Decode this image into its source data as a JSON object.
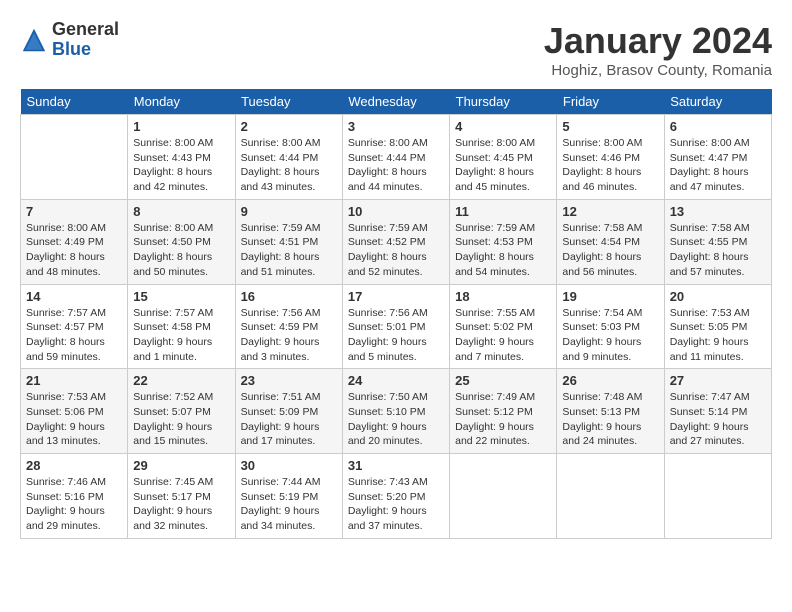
{
  "logo": {
    "general": "General",
    "blue": "Blue"
  },
  "header": {
    "month_title": "January 2024",
    "location": "Hoghiz, Brasov County, Romania"
  },
  "weekdays": [
    "Sunday",
    "Monday",
    "Tuesday",
    "Wednesday",
    "Thursday",
    "Friday",
    "Saturday"
  ],
  "weeks": [
    [
      {
        "day": "",
        "sunrise": "",
        "sunset": "",
        "daylight": ""
      },
      {
        "day": "1",
        "sunrise": "Sunrise: 8:00 AM",
        "sunset": "Sunset: 4:43 PM",
        "daylight": "Daylight: 8 hours and 42 minutes."
      },
      {
        "day": "2",
        "sunrise": "Sunrise: 8:00 AM",
        "sunset": "Sunset: 4:44 PM",
        "daylight": "Daylight: 8 hours and 43 minutes."
      },
      {
        "day": "3",
        "sunrise": "Sunrise: 8:00 AM",
        "sunset": "Sunset: 4:44 PM",
        "daylight": "Daylight: 8 hours and 44 minutes."
      },
      {
        "day": "4",
        "sunrise": "Sunrise: 8:00 AM",
        "sunset": "Sunset: 4:45 PM",
        "daylight": "Daylight: 8 hours and 45 minutes."
      },
      {
        "day": "5",
        "sunrise": "Sunrise: 8:00 AM",
        "sunset": "Sunset: 4:46 PM",
        "daylight": "Daylight: 8 hours and 46 minutes."
      },
      {
        "day": "6",
        "sunrise": "Sunrise: 8:00 AM",
        "sunset": "Sunset: 4:47 PM",
        "daylight": "Daylight: 8 hours and 47 minutes."
      }
    ],
    [
      {
        "day": "7",
        "sunrise": "Sunrise: 8:00 AM",
        "sunset": "Sunset: 4:49 PM",
        "daylight": "Daylight: 8 hours and 48 minutes."
      },
      {
        "day": "8",
        "sunrise": "Sunrise: 8:00 AM",
        "sunset": "Sunset: 4:50 PM",
        "daylight": "Daylight: 8 hours and 50 minutes."
      },
      {
        "day": "9",
        "sunrise": "Sunrise: 7:59 AM",
        "sunset": "Sunset: 4:51 PM",
        "daylight": "Daylight: 8 hours and 51 minutes."
      },
      {
        "day": "10",
        "sunrise": "Sunrise: 7:59 AM",
        "sunset": "Sunset: 4:52 PM",
        "daylight": "Daylight: 8 hours and 52 minutes."
      },
      {
        "day": "11",
        "sunrise": "Sunrise: 7:59 AM",
        "sunset": "Sunset: 4:53 PM",
        "daylight": "Daylight: 8 hours and 54 minutes."
      },
      {
        "day": "12",
        "sunrise": "Sunrise: 7:58 AM",
        "sunset": "Sunset: 4:54 PM",
        "daylight": "Daylight: 8 hours and 56 minutes."
      },
      {
        "day": "13",
        "sunrise": "Sunrise: 7:58 AM",
        "sunset": "Sunset: 4:55 PM",
        "daylight": "Daylight: 8 hours and 57 minutes."
      }
    ],
    [
      {
        "day": "14",
        "sunrise": "Sunrise: 7:57 AM",
        "sunset": "Sunset: 4:57 PM",
        "daylight": "Daylight: 8 hours and 59 minutes."
      },
      {
        "day": "15",
        "sunrise": "Sunrise: 7:57 AM",
        "sunset": "Sunset: 4:58 PM",
        "daylight": "Daylight: 9 hours and 1 minute."
      },
      {
        "day": "16",
        "sunrise": "Sunrise: 7:56 AM",
        "sunset": "Sunset: 4:59 PM",
        "daylight": "Daylight: 9 hours and 3 minutes."
      },
      {
        "day": "17",
        "sunrise": "Sunrise: 7:56 AM",
        "sunset": "Sunset: 5:01 PM",
        "daylight": "Daylight: 9 hours and 5 minutes."
      },
      {
        "day": "18",
        "sunrise": "Sunrise: 7:55 AM",
        "sunset": "Sunset: 5:02 PM",
        "daylight": "Daylight: 9 hours and 7 minutes."
      },
      {
        "day": "19",
        "sunrise": "Sunrise: 7:54 AM",
        "sunset": "Sunset: 5:03 PM",
        "daylight": "Daylight: 9 hours and 9 minutes."
      },
      {
        "day": "20",
        "sunrise": "Sunrise: 7:53 AM",
        "sunset": "Sunset: 5:05 PM",
        "daylight": "Daylight: 9 hours and 11 minutes."
      }
    ],
    [
      {
        "day": "21",
        "sunrise": "Sunrise: 7:53 AM",
        "sunset": "Sunset: 5:06 PM",
        "daylight": "Daylight: 9 hours and 13 minutes."
      },
      {
        "day": "22",
        "sunrise": "Sunrise: 7:52 AM",
        "sunset": "Sunset: 5:07 PM",
        "daylight": "Daylight: 9 hours and 15 minutes."
      },
      {
        "day": "23",
        "sunrise": "Sunrise: 7:51 AM",
        "sunset": "Sunset: 5:09 PM",
        "daylight": "Daylight: 9 hours and 17 minutes."
      },
      {
        "day": "24",
        "sunrise": "Sunrise: 7:50 AM",
        "sunset": "Sunset: 5:10 PM",
        "daylight": "Daylight: 9 hours and 20 minutes."
      },
      {
        "day": "25",
        "sunrise": "Sunrise: 7:49 AM",
        "sunset": "Sunset: 5:12 PM",
        "daylight": "Daylight: 9 hours and 22 minutes."
      },
      {
        "day": "26",
        "sunrise": "Sunrise: 7:48 AM",
        "sunset": "Sunset: 5:13 PM",
        "daylight": "Daylight: 9 hours and 24 minutes."
      },
      {
        "day": "27",
        "sunrise": "Sunrise: 7:47 AM",
        "sunset": "Sunset: 5:14 PM",
        "daylight": "Daylight: 9 hours and 27 minutes."
      }
    ],
    [
      {
        "day": "28",
        "sunrise": "Sunrise: 7:46 AM",
        "sunset": "Sunset: 5:16 PM",
        "daylight": "Daylight: 9 hours and 29 minutes."
      },
      {
        "day": "29",
        "sunrise": "Sunrise: 7:45 AM",
        "sunset": "Sunset: 5:17 PM",
        "daylight": "Daylight: 9 hours and 32 minutes."
      },
      {
        "day": "30",
        "sunrise": "Sunrise: 7:44 AM",
        "sunset": "Sunset: 5:19 PM",
        "daylight": "Daylight: 9 hours and 34 minutes."
      },
      {
        "day": "31",
        "sunrise": "Sunrise: 7:43 AM",
        "sunset": "Sunset: 5:20 PM",
        "daylight": "Daylight: 9 hours and 37 minutes."
      },
      {
        "day": "",
        "sunrise": "",
        "sunset": "",
        "daylight": ""
      },
      {
        "day": "",
        "sunrise": "",
        "sunset": "",
        "daylight": ""
      },
      {
        "day": "",
        "sunrise": "",
        "sunset": "",
        "daylight": ""
      }
    ]
  ]
}
